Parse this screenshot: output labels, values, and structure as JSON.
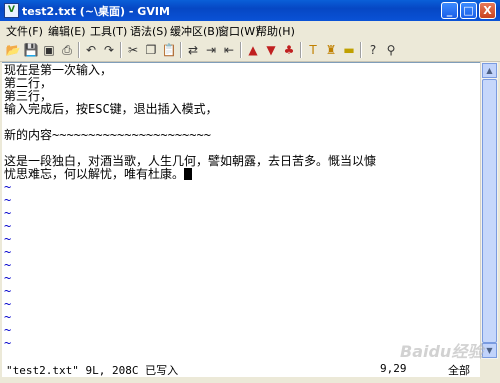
{
  "window": {
    "title": "test2.txt (~\\桌面) - GVIM",
    "icon_letter": "V",
    "minimize_glyph": "_",
    "maximize_glyph": "□",
    "close_glyph": "X"
  },
  "menu": {
    "items": [
      "文件(F)",
      "编辑(E)",
      "工具(T)",
      "语法(S)",
      "缓冲区(B)",
      "窗口(W)",
      "帮助(H)"
    ]
  },
  "toolbar": {
    "icons": [
      "open-icon",
      "save-icon",
      "save-all-icon",
      "print-icon",
      "undo-icon",
      "redo-icon",
      "cut-icon",
      "copy-icon",
      "paste-icon",
      "replace-icon",
      "find-next-icon",
      "find-prev-icon",
      "load-session-icon",
      "save-session-icon",
      "run-script-icon",
      "make-icon",
      "shell-icon",
      "tags-icon",
      "tag-jump-icon",
      "help-icon",
      "find-help-icon"
    ]
  },
  "editor": {
    "lines": [
      "现在是第一次输入，",
      "第二行，",
      "第三行，",
      "输入完成后，按ESC键，退出插入模式，",
      "",
      "新的内容~~~~~~~~~~~~~~~~~~~~~~",
      "",
      "这是一段独白，对酒当歌，人生几何，譬如朝露，去日苦多。慨当以慷",
      "忧思难忘，何以解忧，唯有杜康。"
    ],
    "tilde": "~"
  },
  "status": {
    "message": "\"test2.txt\" 9L, 208C 已写入",
    "position": "9,29",
    "scroll": "全部"
  },
  "watermark": "Baidu经验"
}
